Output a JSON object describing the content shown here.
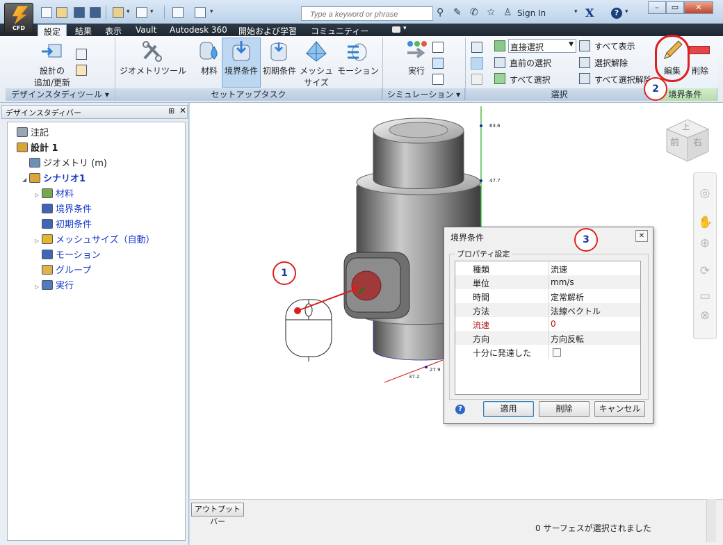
{
  "app": {
    "logo_label": "CFD"
  },
  "search": {
    "placeholder": "Type a keyword or phrase"
  },
  "account": {
    "sign_in": "Sign In"
  },
  "tabs": [
    "設定",
    "結果",
    "表示",
    "Vault",
    "Autodesk 360",
    "開始および学習",
    "コミュニティー"
  ],
  "ribbon": {
    "design_tools": {
      "title": "デザインスタディツール ▾",
      "add_update": [
        "設計の",
        "追加/更新"
      ]
    },
    "setup_tasks": {
      "title": "セットアップタスク",
      "geometry_tools": "ジオメトリツール",
      "material": "材料",
      "boundary": "境界条件",
      "initial": "初期条件",
      "mesh": [
        "メッシュ",
        "サイズ"
      ],
      "motion": "モーション"
    },
    "simulation": {
      "title": "シミュレーション ▾",
      "run": "実行"
    },
    "selection": {
      "title": "選択",
      "direct_select": "直接選択",
      "prev_select": "直前の選択",
      "select_all": "すべて選択",
      "show_all": "すべて表示",
      "deselect": "選択解除",
      "deselect_all": "すべて選択解除"
    },
    "boundary_panel": {
      "title": "境界条件",
      "edit": "編集",
      "delete": "削除"
    }
  },
  "design_study_bar": {
    "title": "デザインスタディバー",
    "tree": [
      {
        "label": "注記",
        "level": 0,
        "expander": "",
        "bold": false,
        "blue": false
      },
      {
        "label": "設計 1",
        "level": 0,
        "expander": "",
        "bold": true,
        "blue": false
      },
      {
        "label": "ジオメトリ (m)",
        "level": 1,
        "expander": "",
        "bold": false,
        "blue": false
      },
      {
        "label": "シナリオ1",
        "level": 1,
        "expander": "◢",
        "bold": true,
        "blue": true
      },
      {
        "label": "材料",
        "level": 2,
        "expander": "▷",
        "bold": false,
        "blue": true
      },
      {
        "label": "境界条件",
        "level": 2,
        "expander": "",
        "bold": false,
        "blue": true
      },
      {
        "label": "初期条件",
        "level": 2,
        "expander": "",
        "bold": false,
        "blue": true
      },
      {
        "label": "メッシュサイズ（自動）",
        "level": 2,
        "expander": "▷",
        "bold": false,
        "blue": true
      },
      {
        "label": "モーション",
        "level": 2,
        "expander": "",
        "bold": false,
        "blue": true
      },
      {
        "label": "グループ",
        "level": 2,
        "expander": "",
        "bold": false,
        "blue": true
      },
      {
        "label": "実行",
        "level": 2,
        "expander": "▷",
        "bold": false,
        "blue": true
      }
    ]
  },
  "viewport": {
    "axis_labels": [
      "63.6",
      "47.7",
      "37.2",
      "27.9"
    ],
    "viewcube": {
      "top": "上",
      "front": "前",
      "right": "右"
    }
  },
  "dialog": {
    "title": "境界条件",
    "group_label": "プロパティ設定",
    "rows": [
      {
        "key": "種類",
        "value": "流速",
        "highlight": false
      },
      {
        "key": "単位",
        "value": "mm/s",
        "highlight": false
      },
      {
        "key": "時間",
        "value": "定常解析",
        "highlight": false
      },
      {
        "key": "方法",
        "value": "法線ベクトル",
        "highlight": false
      },
      {
        "key": "流速",
        "value": "0",
        "highlight": true
      },
      {
        "key": "方向",
        "value": "方向反転",
        "highlight": false
      },
      {
        "key": "十分に発達した",
        "value": "",
        "highlight": false
      }
    ],
    "apply": "適用",
    "delete": "削除",
    "cancel": "キャンセル"
  },
  "output_bar": "アウトプットバー",
  "status": "0 サーフェスが選択されました",
  "callouts": [
    "1",
    "2",
    "3"
  ],
  "colors": {
    "accent_red": "#e01f1f",
    "highlight_red": "#b01515",
    "tree_blue": "#1636c8"
  }
}
